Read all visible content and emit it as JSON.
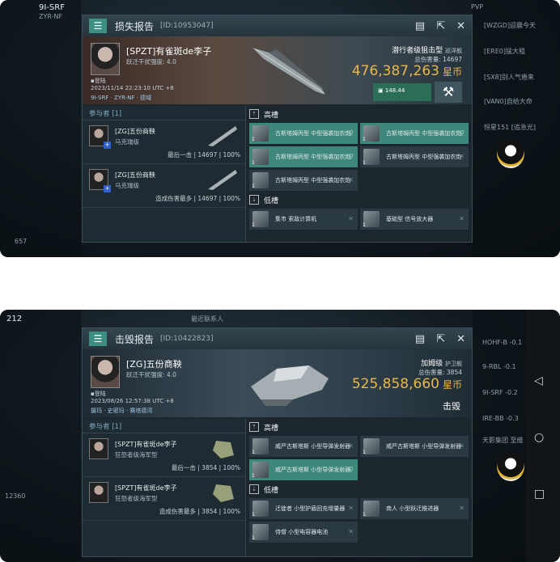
{
  "screens": [
    {
      "report_title": "损失报告",
      "report_id": "[ID:10953047]",
      "victim": {
        "name": "[SPZT]有雀斑de李子",
        "standing": "跃迁干扰强度: 4.0",
        "corp": "▪登陆"
      },
      "time": "2023/11/14 22:23:10 UTC +8",
      "location": "9I-SRF · ZYR-NF · 德域",
      "ship_type": "潜行者级狙击型",
      "ship_class": "巡洋舰",
      "damage_label": "总伤害量:",
      "damage": "14697",
      "isk_value": "476,387,263",
      "isk_unit": "星币",
      "loot": "▣ 148.44",
      "attackers_header": "参与者 [1]",
      "attackers": [
        {
          "name": "[ZG]五份商鞅",
          "ship": "马克瑞级",
          "stat_label": "最后一击",
          "stat": "14697 | 100%"
        },
        {
          "name": "[ZG]五份商鞅",
          "ship": "马克瑞级",
          "stat_label": "造成伤害最多",
          "stat": "14697 | 100%"
        }
      ],
      "high_slot_label": "高槽",
      "high_slots": [
        {
          "name": "古斯塔姆丙型 中型强袭加农炮",
          "qty": "1",
          "state": "dropped"
        },
        {
          "name": "古斯塔姆丙型 中型强袭加农炮",
          "qty": "1",
          "state": "dropped"
        },
        {
          "name": "古斯塔姆丙型 中型强袭加农炮",
          "qty": "1",
          "state": "dropped"
        },
        {
          "name": "古斯塔姆丙型 中型强袭加农炮",
          "qty": "1",
          "state": "destroyed"
        },
        {
          "name": "古斯塔姆丙型 中型强袭加农炮",
          "qty": "1",
          "state": "destroyed"
        }
      ],
      "low_slot_label": "低槽",
      "low_slots": [
        {
          "name": "集市 索敌计算机",
          "qty": "1",
          "state": "destroyed"
        },
        {
          "name": "基础型 信号放大器",
          "qty": "1",
          "state": "destroyed"
        }
      ],
      "bg_labels": [
        "9I-SRF",
        "ZYR-NF",
        "[WZGD]迎晨今天",
        "[ERE0]猛大租",
        "[SX8]别人气倦来",
        "[VAN0]自给大命",
        "恒星151 [追急光]",
        "657",
        "PVP"
      ]
    },
    {
      "report_title": "击毁报告",
      "report_id": "[ID:10422823]",
      "victim": {
        "name": "[ZG]五份商鞅",
        "standing": "跃迁干扰强度: 4.0",
        "corp": "▪登陆"
      },
      "time": "2023/08/26 12:57:38 UTC +8",
      "location": "摄玛 · 史密玛 · 赛塔德湾",
      "ship_type": "加姆级",
      "ship_class": "护卫舰",
      "damage_label": "总伤害量:",
      "damage": "3854",
      "isk_value": "525,858,660",
      "isk_unit": "星币",
      "status": "击毁",
      "attackers_header": "参与者 [1]",
      "attackers": [
        {
          "name": "[SPZT]有雀斑de李子",
          "ship": "狂怒者级海军型",
          "stat_label": "最后一击",
          "stat": "3854 | 100%"
        },
        {
          "name": "[SPZT]有雀斑de李子",
          "ship": "狂怒者级海军型",
          "stat_label": "造成伤害最多",
          "stat": "3854 | 100%"
        }
      ],
      "high_slot_label": "高槽",
      "high_slots": [
        {
          "name": "威严古斯塔斯 小型导弹发射器",
          "qty": "1",
          "state": "destroyed"
        },
        {
          "name": "威严古斯塔斯 小型导弹发射器",
          "qty": "1",
          "state": "destroyed"
        },
        {
          "name": "威严古斯塔斯 小型导弹发射器",
          "qty": "1",
          "state": "dropped"
        }
      ],
      "low_slot_label": "低槽",
      "low_slots": [
        {
          "name": "迁徙者 小型护盾回充增量器",
          "qty": "1",
          "state": "destroyed"
        },
        {
          "name": "商人 小型跃迁推进器",
          "qty": "1",
          "state": "destroyed"
        },
        {
          "name": "侍僧 小型电容器电池",
          "qty": "1",
          "state": "destroyed"
        }
      ],
      "bg_labels": [
        "212",
        "最近联系人",
        "HOHF-B -0.1",
        "9-RBL -0.1",
        "9I-SRF -0.2",
        "IRE-BB -0.3",
        "天影集团 至维",
        "12360"
      ]
    }
  ]
}
